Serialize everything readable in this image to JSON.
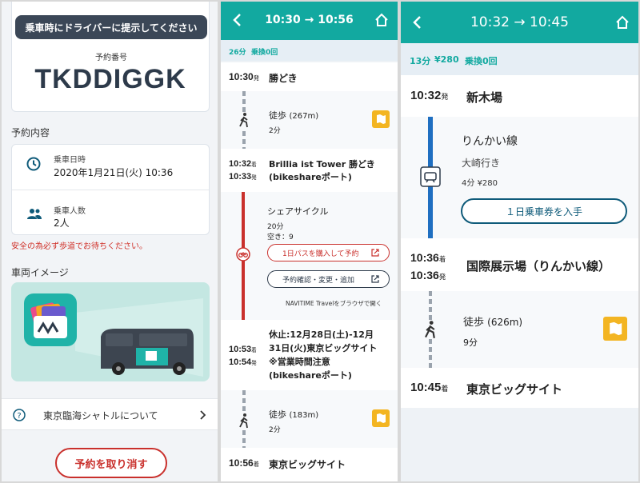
{
  "panel1": {
    "notice": "乗車時にドライバーに提示してください",
    "booking_label": "予約番号",
    "booking_code": "TKDDIGGK",
    "details_title": "予約内容",
    "datetime_label": "乗車日時",
    "datetime_value": "2020年1月21日(火) 10:36",
    "persons_label": "乗車人数",
    "persons_value": "2人",
    "warning": "安全の為必ず歩道でお待ちください。",
    "vehicle_title": "車両イメージ",
    "about_label": "東京臨海シャトルについて",
    "cancel_label": "予約を取り消す",
    "colors": {
      "dark_tag": "#3b4757",
      "warn": "#d0322a",
      "teal": "#12a9a0"
    }
  },
  "panel2": {
    "header_title": "10:30 → 10:56",
    "summary_duration": "26分",
    "summary_transfers": "乗換0回",
    "stop1_time": "10:30",
    "stop1_suffix": "発",
    "stop1_name": "勝どき",
    "walk1_label": "徒歩",
    "walk1_distance": "(267m)",
    "walk1_time": "2分",
    "stop2_time_arr": "10:32",
    "stop2_suffix_arr": "着",
    "stop2_time_dep": "10:33",
    "stop2_suffix_dep": "発",
    "stop2_name_1": "Brillia ist Tower 勝どき",
    "stop2_name_2": "(bikeshareポート)",
    "bike_label": "シェアサイクル",
    "bike_time": "20分",
    "bike_avail": "空き：9",
    "bike_btn1": "1日パスを購入して予約",
    "bike_btn2": "予約確認・変更・追加",
    "bike_note": "NAVITIME Travelをブラウザで開く",
    "stop3_time_arr": "10:53",
    "stop3_suffix_arr": "着",
    "stop3_time_dep": "10:54",
    "stop3_suffix_dep": "発",
    "stop3_name_1": "休止:12月28日(土)-12月",
    "stop3_name_2": "31日(火)東京ビッグサイト",
    "stop3_name_3": "※営業時間注意",
    "stop3_name_4": "(bikeshareポート)",
    "walk2_label": "徒歩",
    "walk2_distance": "(183m)",
    "walk2_time": "2分",
    "stop4_time": "10:56",
    "stop4_suffix": "着",
    "stop4_name": "東京ビッグサイト"
  },
  "panel3": {
    "header_title": "10:32 → 10:45",
    "summary_duration": "13分",
    "summary_fare": "¥280",
    "summary_transfers": "乗換0回",
    "stop1_time": "10:32",
    "stop1_suffix": "発",
    "stop1_name": "新木場",
    "line_name": "りんかい線",
    "line_dest": "大崎行き",
    "line_time": "4分",
    "line_fare": "¥280",
    "ticket_btn": "１日乗車券を入手",
    "stop2_time_arr": "10:36",
    "stop2_suffix_arr": "着",
    "stop2_time_dep": "10:36",
    "stop2_suffix_dep": "発",
    "stop2_name": "国際展示場（りんかい線）",
    "walk_label": "徒歩",
    "walk_distance": "(626m)",
    "walk_time": "9分",
    "stop3_time": "10:45",
    "stop3_suffix": "着",
    "stop3_name": "東京ビッグサイト",
    "colors": {
      "line": "#1f6fc1",
      "walk_dash": "#9aa3ad",
      "map_btn": "#f3b522"
    }
  }
}
